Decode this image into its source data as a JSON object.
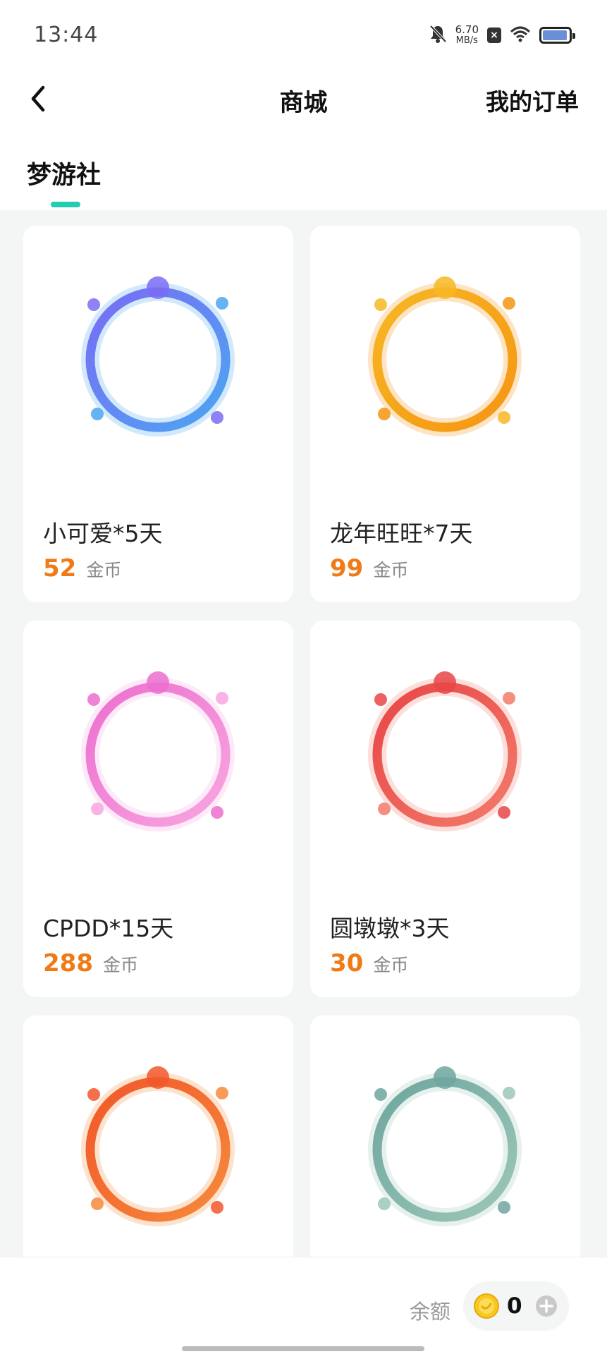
{
  "status_bar": {
    "time": "13:44",
    "net_speed_value": "6.70",
    "net_speed_unit": "MB/s",
    "sim_indicator": "×",
    "battery_level": 0.95
  },
  "nav": {
    "title": "商城",
    "orders_label": "我的订单",
    "back_icon": "chevron-left-icon"
  },
  "tabs": [
    {
      "label": "梦游社",
      "active": true
    }
  ],
  "products": [
    {
      "name": "小可爱*5天",
      "price": "52",
      "currency": "金币",
      "ring": [
        "#7a6cf5",
        "#4ba6f2"
      ]
    },
    {
      "name": "龙年旺旺*7天",
      "price": "99",
      "currency": "金币",
      "ring": [
        "#f7b723",
        "#f59512"
      ]
    },
    {
      "name": "CPDD*15天",
      "price": "288",
      "currency": "金币",
      "ring": [
        "#ec6fcf",
        "#f8a6e0"
      ]
    },
    {
      "name": "圆墩墩*3天",
      "price": "30",
      "currency": "金币",
      "ring": [
        "#e84646",
        "#f37a6b"
      ]
    },
    {
      "name": "",
      "price": "",
      "currency": "",
      "ring": [
        "#f1572a",
        "#f68a3c"
      ]
    },
    {
      "name": "",
      "price": "",
      "currency": "",
      "ring": [
        "#6fa6a0",
        "#9cc7b8"
      ]
    }
  ],
  "footer": {
    "balance_label": "余额",
    "balance_value": "0",
    "coin_icon": "gold-coin-icon",
    "add_icon": "plus-circle-icon"
  },
  "colors": {
    "accent": "#22ccae",
    "price": "#f07a16"
  }
}
